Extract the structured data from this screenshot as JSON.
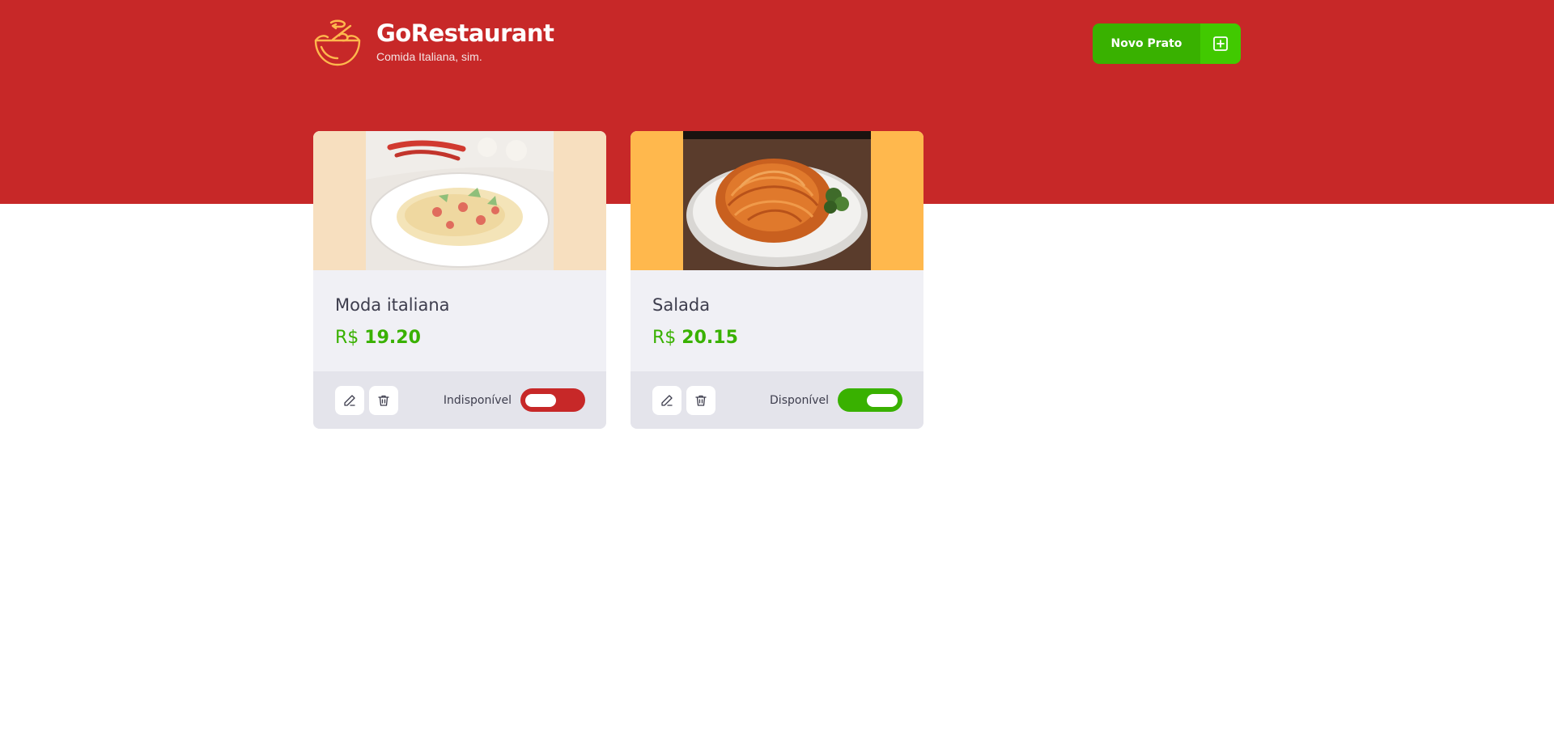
{
  "header": {
    "title": "GoRestaurant",
    "subtitle": "Comida Italiana, sim.",
    "new_button_label": "Novo Prato",
    "logo_icon": "bowl-icon",
    "new_button_icon": "plus-square-icon"
  },
  "colors": {
    "header_bg": "#c72828",
    "accent": "#39b100",
    "accent_light": "#41c900",
    "logo": "#ffb84d",
    "unavailable": "#c72828",
    "available": "#39b100"
  },
  "dishes": [
    {
      "name": "Moda italiana",
      "currency": "R$",
      "price": "19.20",
      "status_label": "Indisponível",
      "available": false
    },
    {
      "name": "Salada",
      "currency": "R$",
      "price": "20.15",
      "status_label": "Disponível",
      "available": true
    }
  ],
  "icons": {
    "edit": "pencil-icon",
    "delete": "trash-icon"
  }
}
